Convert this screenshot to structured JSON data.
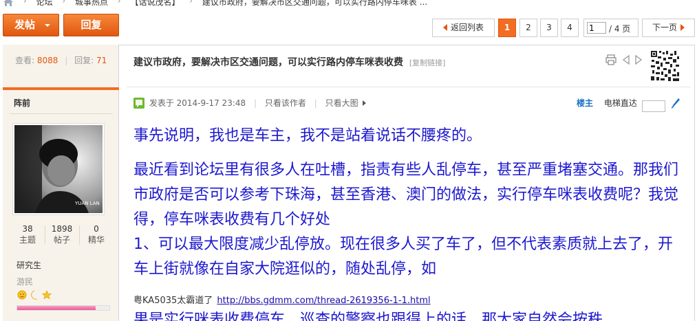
{
  "breadcrumb": {
    "items": [
      "论坛",
      "城事热点",
      "【话说茂名】",
      "建议市政府，要解决市区交通问题，可以实行路内停车咪表 ..."
    ]
  },
  "actions": {
    "post_label": "发帖",
    "reply_label": "回复"
  },
  "pagination": {
    "back_label": "返回列表",
    "pages": [
      "1",
      "2",
      "3",
      "4"
    ],
    "current_page": "1",
    "jump_value": "1",
    "total_label": "/ 4 页",
    "next_label": "下一页"
  },
  "side": {
    "views_label": "查看:",
    "views_value": "8088",
    "replies_label": "回复:",
    "replies_value": "71",
    "author": "阵前",
    "avatar_text": "YUAN LAN",
    "stats": [
      {
        "value": "38",
        "label": "主题"
      },
      {
        "value": "1898",
        "label": "帖子"
      },
      {
        "value": "0",
        "label": "精华"
      }
    ],
    "rank": "研究生",
    "group": "游民",
    "progress": 0.85
  },
  "post": {
    "title": "建议市政府，要解决市区交通问题，可以实行路内停车咪表收费",
    "copy_link": "[复制链接]",
    "posted_label": "发表于 2014-9-17 23:48",
    "only_author": "只看该作者",
    "big_image": "只看大图",
    "floor_label": "楼主",
    "lift_label": "电梯直达",
    "paragraph1": "事先说明，我也是车主，我不是站着说话不腰疼的。",
    "paragraph2": "最近看到论坛里有很多人在吐槽，指责有些人乱停车，甚至严重堵塞交通。那我们市政府是否可以参考下珠海，甚至香港、澳门的做法，实行停车咪表收费呢？我觉得，停车咪表收费有几个好处",
    "paragraph3": "1、可以最大限度减少乱停放。现在很多人买了车了，但不代表素质就上去了，开车上街就像在自家大院逛似的，随处乱停，如",
    "sig_prefix": "粤KA5035太霸道了",
    "sig_link": "http://bbs.gdmm.com/thread-2619356-1-1.html",
    "cut_line": "果是实行咪表收费停车，巡查的警察也跟得上的话，那大家自然会按秩"
  },
  "colors": {
    "accent": "#f26c21",
    "body_text": "#1d18ce",
    "link": "#1a0dab"
  }
}
